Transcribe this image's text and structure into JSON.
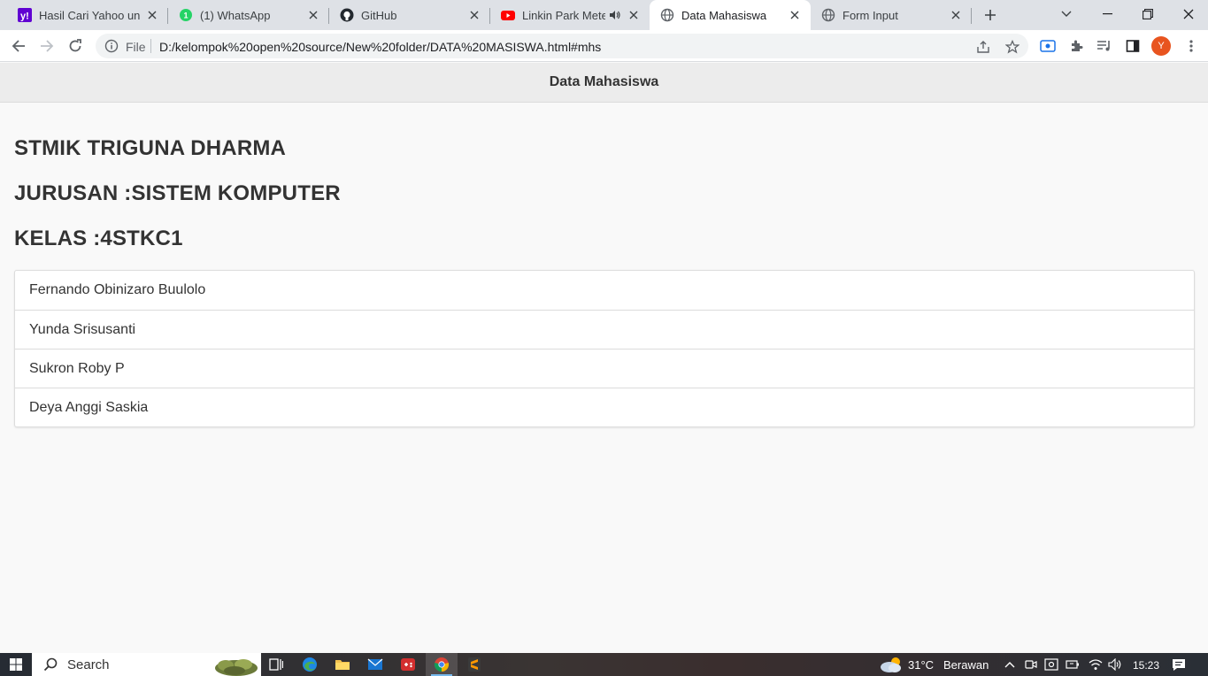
{
  "browser": {
    "tabs": [
      {
        "title": "Hasil Cari Yahoo untuk",
        "icon": "yahoo-icon",
        "active": false
      },
      {
        "title": "(1) WhatsApp",
        "icon": "whatsapp-icon",
        "active": false
      },
      {
        "title": "GitHub",
        "icon": "github-icon",
        "active": false
      },
      {
        "title": "Linkin Park Meteo",
        "icon": "youtube-icon",
        "active": false,
        "audio": true
      },
      {
        "title": "Data Mahasiswa",
        "icon": "globe-icon",
        "active": true
      },
      {
        "title": "Form Input",
        "icon": "globe-icon",
        "active": false
      }
    ],
    "address": {
      "scheme": "File",
      "url": "D:/kelompok%20open%20source/New%20folder/DATA%20MASISWA.html#mhs"
    },
    "profile_initial": "Y"
  },
  "page": {
    "header_title": "Data Mahasiswa",
    "headings": [
      "STMIK TRIGUNA DHARMA",
      "JURUSAN :SISTEM KOMPUTER",
      "KELAS :4STKC1"
    ],
    "students": [
      "Fernando Obinizaro Buulolo",
      "Yunda Srisusanti",
      "Sukron Roby P",
      "Deya Anggi Saskia"
    ]
  },
  "taskbar": {
    "search_placeholder": "Search",
    "weather_temp": "31°C",
    "weather_desc": "Berawan",
    "time": "15:23"
  },
  "colors": {
    "accent_blue": "#1a73e8",
    "avatar": "#e8541f",
    "yahoo": "#6001d2",
    "whatsapp": "#25d366",
    "youtube": "#ff0000"
  }
}
